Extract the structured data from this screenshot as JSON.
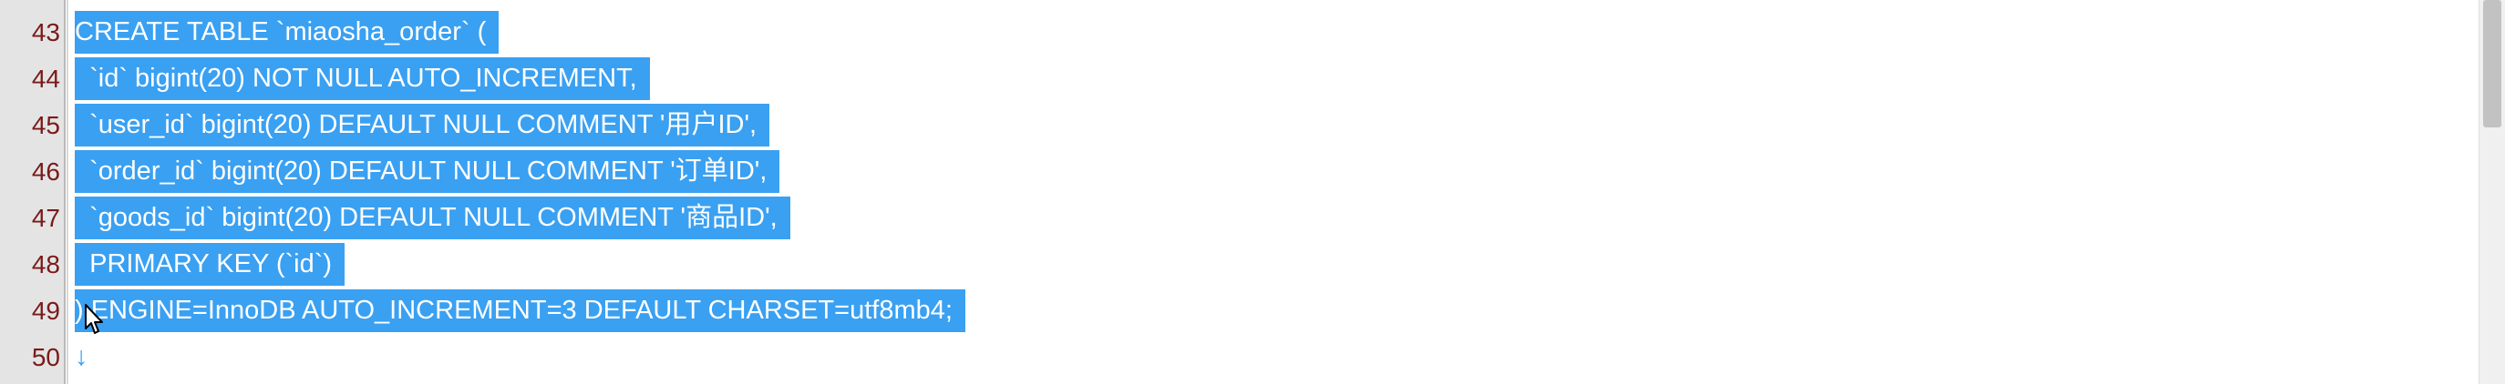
{
  "editor": {
    "lines": [
      {
        "num": "43",
        "text": "CREATE TABLE `miaosha_order` ("
      },
      {
        "num": "44",
        "text": "  `id` bigint(20) NOT NULL AUTO_INCREMENT,"
      },
      {
        "num": "45",
        "text": "  `user_id` bigint(20) DEFAULT NULL COMMENT '用户ID',"
      },
      {
        "num": "46",
        "text": "  `order_id` bigint(20) DEFAULT NULL COMMENT '订单ID',"
      },
      {
        "num": "47",
        "text": "  `goods_id` bigint(20) DEFAULT NULL COMMENT '商品ID',"
      },
      {
        "num": "48",
        "text": "  PRIMARY KEY (`id`)"
      },
      {
        "num": "49",
        "text": ") ENGINE=InnoDB AUTO_INCREMENT=3 DEFAULT CHARSET=utf8mb4;"
      },
      {
        "num": "50",
        "text": "↓"
      }
    ]
  },
  "colors": {
    "selection": "#3aa0f2",
    "gutter": "#e4e4e4",
    "line_number": "#7a1a1a"
  },
  "icons": {
    "cursor": "mouse-pointer-icon"
  }
}
